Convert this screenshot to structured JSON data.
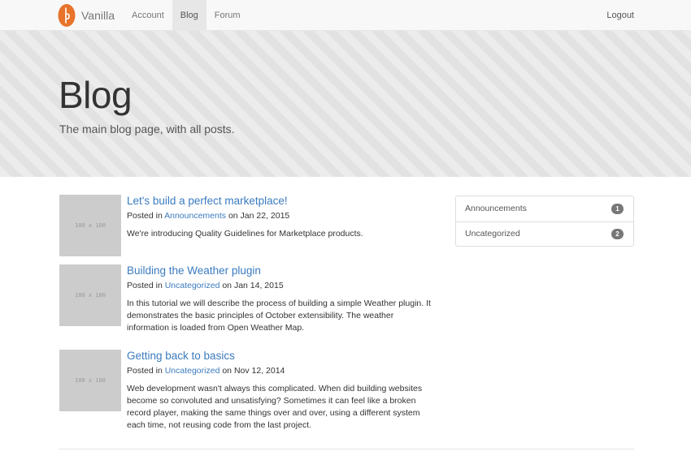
{
  "nav": {
    "brand": "Vanilla",
    "items": [
      {
        "label": "Account",
        "active": false
      },
      {
        "label": "Blog",
        "active": true
      },
      {
        "label": "Forum",
        "active": false
      }
    ],
    "logout": "Logout",
    "brand_color": "#e8732a"
  },
  "hero": {
    "title": "Blog",
    "subtitle": "The main blog page, with all posts."
  },
  "posts": [
    {
      "thumb": "100 x 100",
      "title": "Let's build a perfect marketplace!",
      "posted_in": "Posted in",
      "category": "Announcements",
      "on": "on Jan 22, 2015",
      "excerpt": "We're introducing Quality Guidelines for Marketplace products."
    },
    {
      "thumb": "100 x 100",
      "title": "Building the Weather plugin",
      "posted_in": "Posted in",
      "category": "Uncategorized",
      "on": "on Jan 14, 2015",
      "excerpt": "In this tutorial we will describe the process of building a simple Weather plugin. It demonstrates the basic principles of October extensibility. The weather information is loaded from Open Weather Map."
    },
    {
      "thumb": "100 x 100",
      "title": "Getting back to basics",
      "posted_in": "Posted in",
      "category": "Uncategorized",
      "on": "on Nov 12, 2014",
      "excerpt": "Web development wasn't always this complicated. When did building websites become so convoluted and unsatisfying? Sometimes it can feel like a broken record player, making the same things over and over, using a different system each time, not reusing code from the last project."
    }
  ],
  "categories": [
    {
      "name": "Announcements",
      "count": "1"
    },
    {
      "name": "Uncategorized",
      "count": "2"
    }
  ]
}
